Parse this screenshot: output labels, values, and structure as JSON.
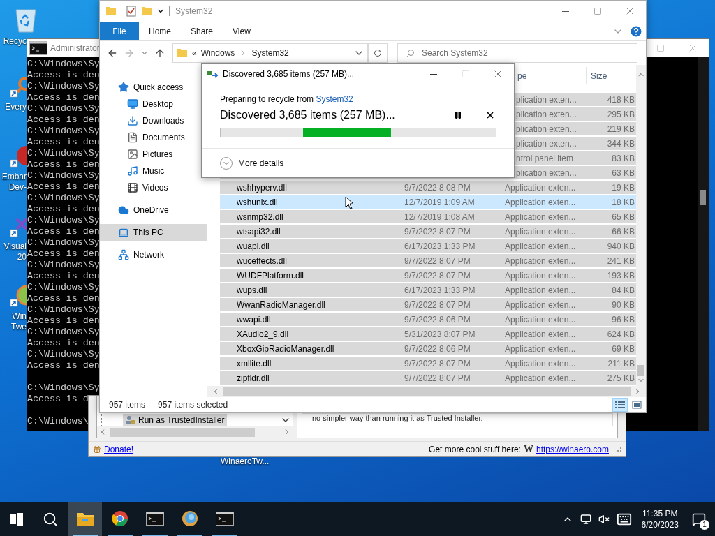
{
  "desktop": {
    "icons": [
      {
        "kind": "bin",
        "label_lines": [
          "Recyc"
        ]
      },
      {
        "kind": "magnifier",
        "label_lines": [
          "Every"
        ]
      },
      {
        "kind": "disc",
        "label_lines": [
          "Embar",
          "Dev-"
        ]
      },
      {
        "kind": "knot",
        "label_lines": [
          "Visual",
          "20"
        ]
      },
      {
        "kind": "ball",
        "label_lines": [
          "Win",
          "Twe"
        ]
      }
    ],
    "lower_label": "WinaeroTw..."
  },
  "cmd": {
    "title": "Administrator",
    "blocks": [
      [
        "C:\\Windows\\Sy",
        "Access is den",
        "C:\\Windows\\Sy",
        "Access is den",
        "C:\\Windows\\Sy",
        "Access is den",
        "C:\\Windows\\Sy",
        "Access is den",
        "C:\\Windows\\Sy",
        "Access is den",
        "C:\\Windows\\Sy",
        "Access is den",
        "C:\\Windows\\Sy",
        "Access is den",
        "C:\\Windows\\Sy",
        "Access is den",
        "C:\\Windows\\Sy",
        "Access is den",
        "C:\\Windows\\Sy",
        "Access is den",
        "C:\\Windows\\Sy",
        "Access is den",
        "C:\\Windows\\Sy",
        "Access is den",
        "C:\\Windows\\Sy",
        "Access is den",
        "C:\\Windows\\Sy",
        "Access is den"
      ],
      [
        "C:\\Windows\\Sy",
        "Access is d"
      ],
      [
        "C:\\Windows\\"
      ]
    ]
  },
  "winaero": {
    "tree_item": "Run as TrustedInstaller",
    "description": "no simpler way than running it as Trusted Installer.",
    "donate": "Donate!",
    "promo": "Get more cool stuff here:",
    "logo_letter": "W",
    "link": "https://winaero.com"
  },
  "explorer": {
    "title": "System32",
    "ribbon_tabs": [
      {
        "label": "File",
        "kind": "menu"
      },
      {
        "label": "Home",
        "kind": "tab"
      },
      {
        "label": "Share",
        "kind": "tab"
      },
      {
        "label": "View",
        "kind": "tab"
      }
    ],
    "overflow_mark": "«",
    "path": [
      "Windows",
      "System32"
    ],
    "search": {
      "placeholder": "Search System32"
    },
    "nav": [
      {
        "label": "Quick access",
        "kind": "star",
        "selected": false,
        "children": [
          {
            "label": "Desktop",
            "kind": "desktop",
            "selected": false
          },
          {
            "label": "Downloads",
            "kind": "download",
            "selected": false
          },
          {
            "label": "Documents",
            "kind": "document",
            "selected": false
          },
          {
            "label": "Pictures",
            "kind": "picture",
            "selected": false
          },
          {
            "label": "Music",
            "kind": "music",
            "selected": false
          },
          {
            "label": "Videos",
            "kind": "video",
            "selected": false
          }
        ]
      },
      {
        "label": "OneDrive",
        "kind": "cloud",
        "selected": false
      },
      {
        "label": "This PC",
        "kind": "pc",
        "selected": true
      },
      {
        "label": "Network",
        "kind": "network",
        "selected": false
      }
    ],
    "headers": {
      "type": "pe",
      "size": "Size"
    },
    "rows": [
      {
        "kind": "partial",
        "type": "plication exten...",
        "size": "418 KB",
        "selected": true,
        "hovered": false
      },
      {
        "kind": "partial",
        "type": "plication exten...",
        "size": "295 KB",
        "selected": true,
        "hovered": false
      },
      {
        "kind": "partial",
        "type": "plication exten...",
        "size": "219 KB",
        "selected": true,
        "hovered": false
      },
      {
        "kind": "partial",
        "type": "plication exten...",
        "size": "344 KB",
        "selected": true,
        "hovered": false
      },
      {
        "kind": "partial",
        "type": "ntrol panel item",
        "size": "83 KB",
        "selected": true,
        "hovered": false
      },
      {
        "kind": "partial",
        "type": "plication exten...",
        "size": "63 KB",
        "selected": true,
        "hovered": false
      },
      {
        "kind": "full",
        "name": "wshhyperv.dll",
        "modified": "9/7/2022 8:08 PM",
        "type": "Application exten...",
        "size": "19 KB",
        "selected": true,
        "hovered": false
      },
      {
        "kind": "full",
        "name": "wshunix.dll",
        "modified": "12/7/2019 1:09 AM",
        "type": "Application exten...",
        "size": "18 KB",
        "selected": true,
        "hovered": true
      },
      {
        "kind": "full",
        "name": "wsnmp32.dll",
        "modified": "12/7/2019 1:08 AM",
        "type": "Application exten...",
        "size": "65 KB",
        "selected": true,
        "hovered": false
      },
      {
        "kind": "full",
        "name": "wtsapi32.dll",
        "modified": "9/7/2022 8:07 PM",
        "type": "Application exten...",
        "size": "66 KB",
        "selected": true,
        "hovered": false
      },
      {
        "kind": "full",
        "name": "wuapi.dll",
        "modified": "6/17/2023 1:33 PM",
        "type": "Application exten...",
        "size": "940 KB",
        "selected": true,
        "hovered": false
      },
      {
        "kind": "full",
        "name": "wuceffects.dll",
        "modified": "9/7/2022 8:07 PM",
        "type": "Application exten...",
        "size": "241 KB",
        "selected": true,
        "hovered": false
      },
      {
        "kind": "full",
        "name": "WUDFPlatform.dll",
        "modified": "9/7/2022 8:07 PM",
        "type": "Application exten...",
        "size": "193 KB",
        "selected": true,
        "hovered": false
      },
      {
        "kind": "full",
        "name": "wups.dll",
        "modified": "6/17/2023 1:33 PM",
        "type": "Application exten...",
        "size": "84 KB",
        "selected": true,
        "hovered": false
      },
      {
        "kind": "full",
        "name": "WwanRadioManager.dll",
        "modified": "9/7/2022 8:07 PM",
        "type": "Application exten...",
        "size": "90 KB",
        "selected": true,
        "hovered": false
      },
      {
        "kind": "full",
        "name": "wwapi.dll",
        "modified": "9/7/2022 8:06 PM",
        "type": "Application exten...",
        "size": "96 KB",
        "selected": true,
        "hovered": false
      },
      {
        "kind": "full",
        "name": "XAudio2_9.dll",
        "modified": "5/31/2023 8:07 PM",
        "type": "Application exten...",
        "size": "624 KB",
        "selected": true,
        "hovered": false
      },
      {
        "kind": "full",
        "name": "XboxGipRadioManager.dll",
        "modified": "9/7/2022 8:06 PM",
        "type": "Application exten...",
        "size": "69 KB",
        "selected": true,
        "hovered": false
      },
      {
        "kind": "full",
        "name": "xmllite.dll",
        "modified": "9/7/2022 8:07 PM",
        "type": "Application exten...",
        "size": "211 KB",
        "selected": true,
        "hovered": false
      },
      {
        "kind": "full",
        "name": "zipfldr.dll",
        "modified": "9/7/2022 8:07 PM",
        "type": "Application exten...",
        "size": "275 KB",
        "selected": true,
        "hovered": false
      }
    ],
    "status": {
      "count": "957 items",
      "selection": "957 items selected"
    },
    "views": [
      {
        "kind": "details",
        "selected": true
      },
      {
        "kind": "tiles",
        "selected": false
      }
    ]
  },
  "dialog": {
    "title": "Discovered 3,685 items (257 MB)...",
    "intro": "Preparing to recycle from",
    "source": "System32",
    "headline": "Discovered 3,685 items (257 MB)...",
    "progress": {
      "indeterminate": true
    },
    "maximize_disabled": true,
    "details_label": "More details"
  },
  "taskbar": {
    "apps": [
      {
        "kind": "folder",
        "active": true,
        "running": true
      },
      {
        "kind": "browser",
        "active": false,
        "running": true
      },
      {
        "kind": "console",
        "active": false,
        "running": true
      },
      {
        "kind": "globe",
        "active": false,
        "running": true
      },
      {
        "kind": "console",
        "active": false,
        "running": true
      }
    ],
    "muted": true,
    "time": "11:35 PM",
    "date": "6/20/2023",
    "notification_count": "1"
  }
}
